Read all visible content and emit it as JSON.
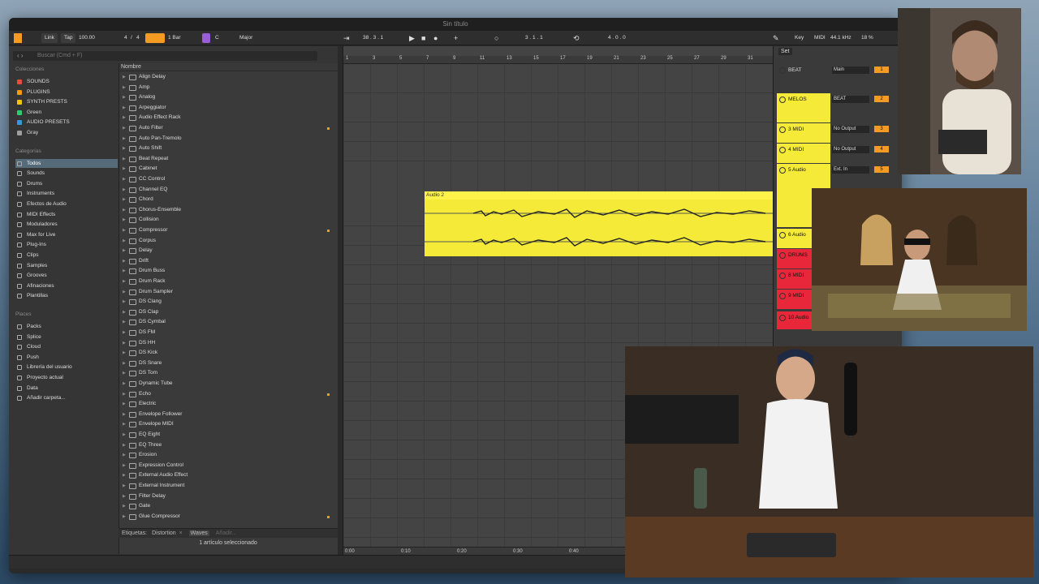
{
  "app": {
    "title": "Sin título"
  },
  "toolbar": {
    "link": "Link",
    "tap": "Tap",
    "tempo": "100.00",
    "sig_num": "4",
    "sig_sep": "/",
    "sig_den": "4",
    "quant": "1 Bar",
    "key": "C",
    "scale": "Major",
    "position": "38 .  3 .  1",
    "punch": "3 .  1 .  1",
    "loop_len": "4 .  0 .  0",
    "key_label": "Key",
    "midi_label": "MIDI",
    "sample_rate": "44.1 kHz",
    "cpu": "18 %"
  },
  "browser": {
    "search_placeholder": "Buscar (Cmd + F)",
    "colecciones_header": "Colecciones",
    "colecciones": [
      {
        "label": "SOUNDS",
        "color": "#e74c3c"
      },
      {
        "label": "PLUGINS",
        "color": "#f39c12"
      },
      {
        "label": "SYNTH PRESTS",
        "color": "#f1c40f"
      },
      {
        "label": "Green",
        "color": "#2ecc71"
      },
      {
        "label": "AUDIO PRESETS",
        "color": "#3498db"
      },
      {
        "label": "Gray",
        "color": "#9e9e9e"
      }
    ],
    "categorias_header": "Categorías",
    "categorias": [
      "Todos",
      "Sounds",
      "Drums",
      "Instruments",
      "Efectos de Audio",
      "MIDI Effects",
      "Moduladores",
      "Max for Live",
      "Plug-Ins",
      "Clips",
      "Samples",
      "Grooves",
      "Afinaciones",
      "Plantillas"
    ],
    "places_header": "Places",
    "places": [
      "Packs",
      "Splice",
      "Cloud",
      "Push",
      "Librería del usuario",
      "Proyecto actual",
      "Data",
      "Añadir carpeta..."
    ],
    "list_header": "Nombre",
    "devices": [
      "Align Delay",
      "Amp",
      "Analog",
      "Arpeggiator",
      "Audio Effect Rack",
      "Auto Filter",
      "Auto Pan-Tremolo",
      "Auto Shift",
      "Beat Repeat",
      "Cabinet",
      "CC Control",
      "Channel EQ",
      "Chord",
      "Chorus-Ensemble",
      "Collision",
      "Compressor",
      "Corpus",
      "Delay",
      "Drift",
      "Drum Buss",
      "Drum Rack",
      "Drum Sampler",
      "DS Clang",
      "DS Clap",
      "DS Cymbal",
      "DS FM",
      "DS HH",
      "DS Kick",
      "DS Snare",
      "DS Tom",
      "Dynamic Tube",
      "Echo",
      "Electric",
      "Envelope Follower",
      "Envelope MIDI",
      "EQ Eight",
      "EQ Three",
      "Erosion",
      "Expression Control",
      "External Audio Effect",
      "External Instrument",
      "Filter Delay",
      "Gate",
      "Glue Compressor"
    ],
    "tags_label": "Etiquetas:",
    "tags": [
      "Distortion",
      "Waves",
      "Añadir..."
    ],
    "status": "1 artículo seleccionado"
  },
  "arrangement": {
    "ruler": [
      "1",
      "3",
      "5",
      "7",
      "9",
      "11",
      "13",
      "15",
      "17",
      "19",
      "21",
      "23",
      "25",
      "27",
      "29",
      "31"
    ],
    "clip_name": "Audio 2",
    "times": [
      "0:00",
      "0:10",
      "0:20",
      "0:30",
      "0:40"
    ]
  },
  "mixer": {
    "set_label": "Set",
    "tracks": [
      {
        "name": "BEAT",
        "io": "Main",
        "num": "1",
        "color": "#3a3a3a"
      },
      {
        "name": "MELOS",
        "io": "BEAT",
        "num": "2",
        "color": "#f4ea37"
      },
      {
        "name": "3 MIDI",
        "io": "No Output",
        "num": "3",
        "color": "#f4ea37"
      },
      {
        "name": "4 MIDI",
        "io": "No Output",
        "num": "4",
        "color": "#f4ea37"
      },
      {
        "name": "5 Audio",
        "io": "Ext. In",
        "num": "5",
        "color": "#f4ea37"
      },
      {
        "name": "6 Audio",
        "io": "",
        "num": "6",
        "color": "#f4ea37"
      },
      {
        "name": "DRUMS",
        "io": "",
        "num": "7",
        "color": "#e8283a"
      },
      {
        "name": "8 MIDI",
        "io": "",
        "num": "8",
        "color": "#e8283a"
      },
      {
        "name": "9 MIDI",
        "io": "",
        "num": "9",
        "color": "#e8283a"
      },
      {
        "name": "10 Audio",
        "io": "DRUMS",
        "num": "10",
        "color": "#e8283a"
      }
    ]
  }
}
